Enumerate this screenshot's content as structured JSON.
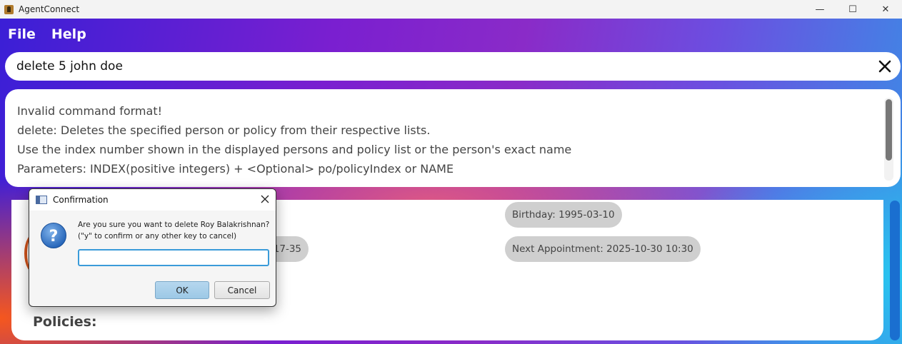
{
  "window": {
    "title": "AgentConnect",
    "controls": {
      "minimize": "—",
      "maximize": "☐",
      "close": "✕"
    }
  },
  "menu": {
    "items": [
      "File",
      "Help"
    ]
  },
  "command": {
    "value": "delete 5 john doe"
  },
  "result": {
    "lines": [
      "Invalid command format!",
      "delete: Deletes the specified person or policy from their respective lists.",
      "Use the index number shown in the displayed persons and policy list or the person's exact name",
      "Parameters: INDEX(positive integers) + <Optional> po/policyIndex or NAME"
    ]
  },
  "person": {
    "partial_chip": "17-35",
    "birthday": "Birthday: 1995-03-10",
    "next_appointment": "Next Appointment: 2025-10-30 10:30",
    "policies_label": "Policies:"
  },
  "dialog": {
    "title": "Confirmation",
    "message_line1": "Are you sure you want to delete Roy Balakrishnan?",
    "message_line2": "(\"y\" to confirm or any other key to cancel)",
    "input_value": "",
    "ok_label": "OK",
    "cancel_label": "Cancel"
  }
}
